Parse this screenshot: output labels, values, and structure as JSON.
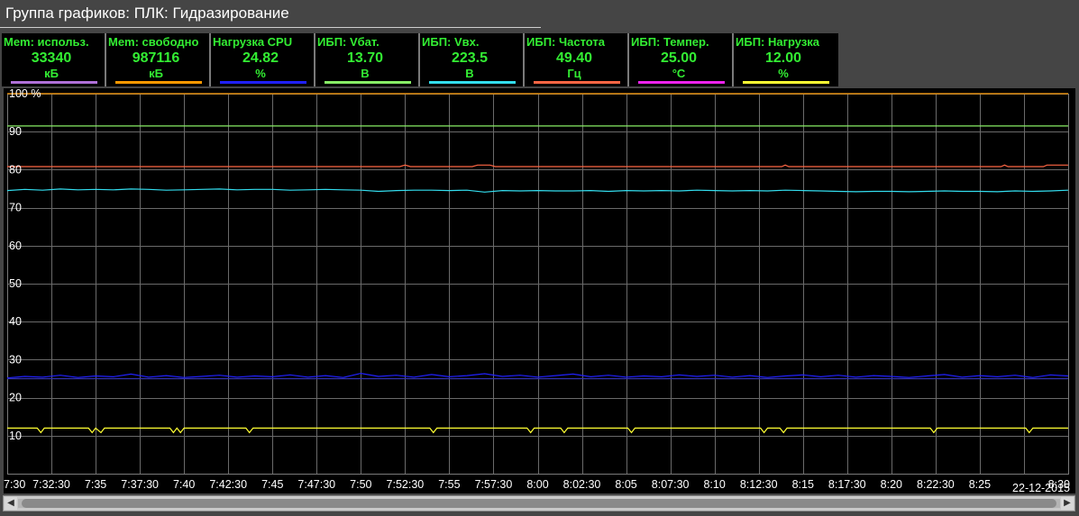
{
  "window": {
    "title": "Группа графиков: ПЛК: Гидразирование"
  },
  "legend": [
    {
      "title": "Mem: использ.",
      "value": "33340",
      "unit": "кБ",
      "color": "#b070d8"
    },
    {
      "title": "Mem: свободно",
      "value": "987116",
      "unit": "кБ",
      "color": "#ff9900"
    },
    {
      "title": "Нагрузка CPU",
      "value": "24.82",
      "unit": "%",
      "color": "#2020ff"
    },
    {
      "title": "ИБП: Vбат.",
      "value": "13.70",
      "unit": "В",
      "color": "#88ee66"
    },
    {
      "title": "ИБП: Vвх.",
      "value": "223.5",
      "unit": "В",
      "color": "#33ddee"
    },
    {
      "title": "ИБП: Частота",
      "value": "49.40",
      "unit": "Гц",
      "color": "#ff6644"
    },
    {
      "title": "ИБП: Темпер.",
      "value": "25.00",
      "unit": "°C",
      "color": "#ee22ee"
    },
    {
      "title": "ИБП: Нагрузка",
      "value": "12.00",
      "unit": "%",
      "color": "#ffff33"
    }
  ],
  "chart_data": {
    "type": "line",
    "ylim": [
      0,
      100
    ],
    "y_ticks": [
      "100 %",
      "90",
      "80",
      "70",
      "60",
      "50",
      "40",
      "30",
      "20",
      "10"
    ],
    "y_tick_values": [
      100,
      90,
      80,
      70,
      60,
      50,
      40,
      30,
      20,
      10
    ],
    "x_ticks": [
      "7:30",
      "7:32:30",
      "7:35",
      "7:37:30",
      "7:40",
      "7:42:30",
      "7:45",
      "7:47:30",
      "7:50",
      "7:52:30",
      "7:55",
      "7:57:30",
      "8:00",
      "8:02:30",
      "8:05",
      "8:07:30",
      "8:10",
      "8:12:30",
      "8:15",
      "8:17:30",
      "8:20",
      "8:22:30",
      "8:25",
      "8:30"
    ],
    "x_tick_minutes": [
      0,
      2.5,
      5,
      7.5,
      10,
      12.5,
      15,
      17.5,
      20,
      22.5,
      25,
      27.5,
      30,
      32.5,
      35,
      37.5,
      40,
      42.5,
      45,
      47.5,
      50,
      52.5,
      55,
      60
    ],
    "x_minor_minutes": [
      57.5
    ],
    "date": "22-12-2015",
    "grid": true,
    "series": [
      {
        "name": "Mem: свободно",
        "color": "#ff9900",
        "x": [
          0,
          60
        ],
        "y": [
          100,
          100
        ]
      },
      {
        "name": "ИБП: Vбат.",
        "color": "#88ee66",
        "x": [
          0,
          60
        ],
        "y": [
          91.5,
          91.5
        ]
      },
      {
        "name": "ИБП: Частота",
        "color": "#ff6644",
        "x": [
          0,
          22.2,
          22.5,
          22.8,
          26.3,
          26.6,
          27.3,
          27.6,
          43.8,
          44,
          44.2,
          56.2,
          56.4,
          56.6,
          58.6,
          58.8,
          60
        ],
        "y": [
          80.8,
          80.8,
          81.2,
          80.8,
          80.8,
          81.2,
          81.2,
          80.8,
          80.8,
          81.2,
          80.8,
          80.8,
          81.2,
          80.8,
          80.8,
          81.2,
          81.2
        ]
      },
      {
        "name": "ИБП: Vвх.",
        "color": "#33ddee",
        "x": [
          0,
          1,
          2,
          3,
          4,
          5,
          6,
          7,
          8,
          9,
          10,
          11,
          12,
          13,
          14,
          15,
          16,
          17,
          18,
          19,
          20,
          21,
          22,
          23,
          24,
          25,
          26,
          27,
          28,
          29,
          30,
          31,
          32,
          33,
          34,
          35,
          36,
          37,
          38,
          39,
          40,
          41,
          42,
          43,
          44,
          45,
          46,
          47,
          48,
          49,
          50,
          51,
          52,
          53,
          54,
          55,
          56,
          57,
          58,
          59,
          60
        ],
        "y": [
          74.5,
          74.8,
          74.6,
          74.9,
          74.7,
          74.8,
          74.7,
          74.9,
          74.8,
          74.6,
          74.7,
          74.8,
          74.9,
          74.7,
          74.8,
          74.8,
          74.6,
          74.7,
          74.8,
          74.7,
          74.6,
          74.3,
          74.5,
          74.6,
          74.6,
          74.5,
          74.6,
          74.1,
          74.5,
          74.4,
          74.5,
          74.4,
          74.4,
          74.5,
          74.3,
          74.5,
          74.4,
          74.5,
          74.4,
          74.6,
          74.5,
          74.4,
          74.5,
          74.4,
          74.6,
          74.5,
          74.4,
          74.3,
          74.2,
          74.3,
          74.3,
          74.2,
          74.3,
          74.4,
          74.3,
          74.3,
          74.2,
          74.4,
          74.3,
          74.4,
          74.6
        ]
      },
      {
        "name": "Нагрузка CPU",
        "color": "#2020ff",
        "x": [
          0,
          1,
          2,
          3,
          4,
          5,
          6,
          7,
          8,
          9,
          10,
          11,
          12,
          13,
          14,
          15,
          16,
          17,
          18,
          19,
          20,
          21,
          22,
          23,
          24,
          25,
          26,
          27,
          28,
          29,
          30,
          31,
          32,
          33,
          34,
          35,
          36,
          37,
          38,
          39,
          40,
          41,
          42,
          43,
          44,
          45,
          46,
          47,
          48,
          49,
          50,
          51,
          52,
          53,
          54,
          55,
          56,
          57,
          58,
          59,
          60
        ],
        "y": [
          25.2,
          25.6,
          25.4,
          25.9,
          25.3,
          25.7,
          25.5,
          26.2,
          25.4,
          25.8,
          25.3,
          25.6,
          25.9,
          25.4,
          25.7,
          25.5,
          26,
          25.4,
          25.8,
          25.3,
          26.4,
          25.6,
          25.9,
          25.4,
          26.1,
          25.5,
          25.8,
          26.3,
          25.6,
          25.9,
          25.4,
          25.8,
          26.2,
          25.5,
          25.9,
          25.4,
          25.7,
          25.5,
          26,
          25.6,
          25.9,
          25.4,
          25.8,
          25.3,
          25.7,
          26,
          25.5,
          25.9,
          25.4,
          25.8,
          25.6,
          25.3,
          25.7,
          26.1,
          25.4,
          25.8,
          25.5,
          25.9,
          25.3,
          26,
          25.7
        ]
      },
      {
        "name": "CPU: базовая",
        "color": "#3333aa",
        "x": [
          0,
          60
        ],
        "y": [
          25.0,
          25.0
        ]
      },
      {
        "name": "ИБП: Нагрузка",
        "color": "#ffff33",
        "x": [
          0,
          1.7,
          1.9,
          2.1,
          4.6,
          4.8,
          5,
          5.3,
          5.5,
          9.2,
          9.4,
          9.6,
          9.8,
          10,
          13.5,
          13.7,
          13.9,
          23.9,
          24.1,
          24.3,
          29.4,
          29.6,
          29.8,
          31.3,
          31.5,
          31.7,
          35.1,
          35.3,
          35.5,
          42.6,
          42.8,
          43,
          43.7,
          43.9,
          44.1,
          52.2,
          52.4,
          52.6,
          57.6,
          57.8,
          58,
          60
        ],
        "y": [
          12,
          12,
          10.8,
          12,
          12,
          10.8,
          12,
          10.8,
          12,
          12,
          10.8,
          12,
          10.8,
          12,
          12,
          10.8,
          12,
          12,
          10.8,
          12,
          12,
          10.8,
          12,
          12,
          10.8,
          12,
          12,
          10.8,
          12,
          12,
          10.8,
          12,
          12,
          10.8,
          12,
          12,
          10.8,
          12,
          12,
          10.8,
          12,
          12
        ]
      }
    ]
  }
}
